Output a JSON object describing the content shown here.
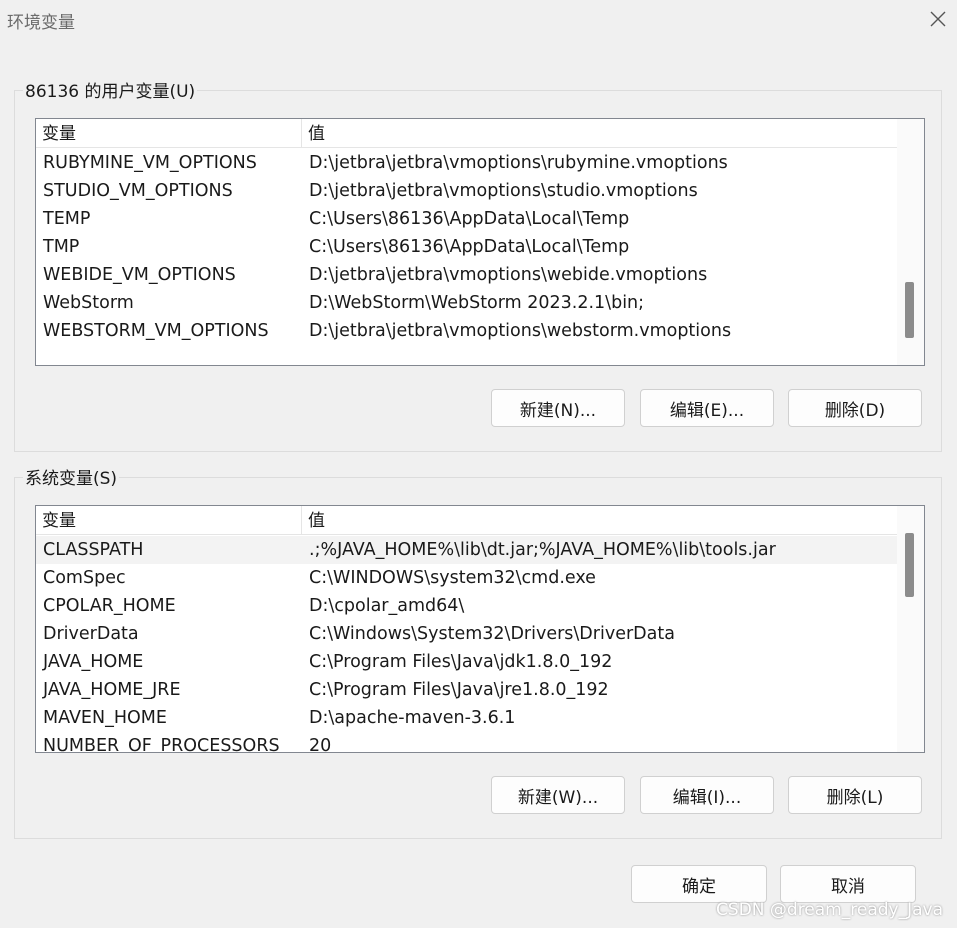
{
  "window": {
    "title": "环境变量",
    "close_icon": "close-icon"
  },
  "user_group": {
    "label": "86136 的用户变量(U)",
    "columns": [
      "变量",
      "值"
    ],
    "rows": [
      {
        "name": "RUBYMINE_VM_OPTIONS",
        "value": "D:\\jetbra\\jetbra\\vmoptions\\rubymine.vmoptions"
      },
      {
        "name": "STUDIO_VM_OPTIONS",
        "value": "D:\\jetbra\\jetbra\\vmoptions\\studio.vmoptions"
      },
      {
        "name": "TEMP",
        "value": "C:\\Users\\86136\\AppData\\Local\\Temp"
      },
      {
        "name": "TMP",
        "value": "C:\\Users\\86136\\AppData\\Local\\Temp"
      },
      {
        "name": "WEBIDE_VM_OPTIONS",
        "value": "D:\\jetbra\\jetbra\\vmoptions\\webide.vmoptions"
      },
      {
        "name": "WebStorm",
        "value": "D:\\WebStorm\\WebStorm 2023.2.1\\bin;"
      },
      {
        "name": "WEBSTORM_VM_OPTIONS",
        "value": "D:\\jetbra\\jetbra\\vmoptions\\webstorm.vmoptions"
      }
    ],
    "buttons": {
      "new": "新建(N)...",
      "edit": "编辑(E)...",
      "delete": "删除(D)"
    }
  },
  "system_group": {
    "label": "系统变量(S)",
    "columns": [
      "变量",
      "值"
    ],
    "rows": [
      {
        "name": "CLASSPATH",
        "value": ".;%JAVA_HOME%\\lib\\dt.jar;%JAVA_HOME%\\lib\\tools.jar",
        "selected": true
      },
      {
        "name": "ComSpec",
        "value": "C:\\WINDOWS\\system32\\cmd.exe"
      },
      {
        "name": "CPOLAR_HOME",
        "value": "D:\\cpolar_amd64\\"
      },
      {
        "name": "DriverData",
        "value": "C:\\Windows\\System32\\Drivers\\DriverData"
      },
      {
        "name": "JAVA_HOME",
        "value": "C:\\Program Files\\Java\\jdk1.8.0_192"
      },
      {
        "name": "JAVA_HOME_JRE",
        "value": "C:\\Program Files\\Java\\jre1.8.0_192"
      },
      {
        "name": "MAVEN_HOME",
        "value": "D:\\apache-maven-3.6.1"
      },
      {
        "name": "NUMBER_OF_PROCESSORS",
        "value": "20"
      }
    ],
    "buttons": {
      "new": "新建(W)...",
      "edit": "编辑(I)...",
      "delete": "删除(L)"
    }
  },
  "footer": {
    "ok": "确定",
    "cancel": "取消"
  },
  "watermark": "CSDN @dream_ready_Java"
}
